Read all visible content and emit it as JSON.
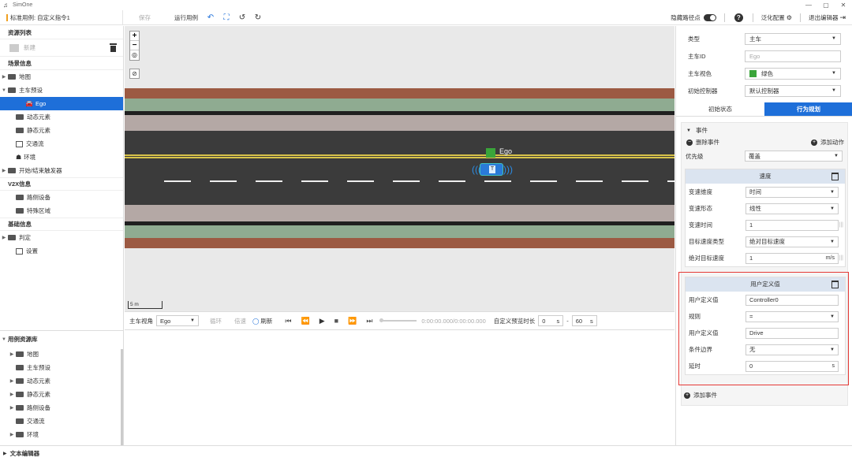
{
  "app": {
    "title": "SimOne"
  },
  "window_controls": {
    "minimize": "—",
    "maximize": "▢",
    "close": "✕"
  },
  "toolbar": {
    "case_name": "标准用例: 自定义指令1",
    "save_label": "保存",
    "run_label": "运行用例",
    "hide_path_label": "隐藏路径点",
    "generalize_label": "泛化配置",
    "exit_label": "退出编辑器"
  },
  "left": {
    "resource_list": "资源列表",
    "new_label": "新建",
    "scene_info": "场景信息",
    "scene_items": [
      {
        "label": "地图"
      },
      {
        "label": "主车预设"
      },
      {
        "label": "Ego"
      },
      {
        "label": "动态元素"
      },
      {
        "label": "静态元素"
      },
      {
        "label": "交通流"
      },
      {
        "label": "环境"
      },
      {
        "label": "开始/结束触发器"
      }
    ],
    "v2x_info": "V2X信息",
    "v2x_items": [
      {
        "label": "路侧设备"
      },
      {
        "label": "特殊区域"
      }
    ],
    "base_info": "基础信息",
    "base_items": [
      {
        "label": "判定"
      },
      {
        "label": "设置"
      }
    ],
    "lib_header": "用例资源库",
    "lib_items": [
      {
        "label": "地图"
      },
      {
        "label": "主车预设"
      },
      {
        "label": "动态元素"
      },
      {
        "label": "静态元素"
      },
      {
        "label": "路侧设备"
      },
      {
        "label": "交通流"
      },
      {
        "label": "环境"
      }
    ]
  },
  "canvas": {
    "ego_label": "Ego",
    "scale_label": "5 m",
    "zoom_in": "+",
    "zoom_out": "−"
  },
  "playbar": {
    "view_label": "主车视角",
    "view_value": "Ego",
    "loop_label": "循环",
    "speed_label": "倍速",
    "refresh_label": "刷新",
    "time_display": "0:00:00.000/0:00:00.000",
    "preview_label": "自定义预览时长",
    "start_value": "0",
    "end_value": "60",
    "unit_s": "s",
    "dash": "-"
  },
  "text_editor": "文本编辑器",
  "right": {
    "props": [
      {
        "label": "类型",
        "value": "主车",
        "type": "select"
      },
      {
        "label": "主车ID",
        "value": "Ego",
        "type": "input"
      },
      {
        "label": "主车视色",
        "value": "绿色",
        "type": "color"
      },
      {
        "label": "初始控制器",
        "value": "默认控制器",
        "type": "select"
      }
    ],
    "tab_initial": "初始状态",
    "tab_behavior": "行为规划",
    "event_label": "事件",
    "delete_event": "删除事件",
    "add_action": "添加动作",
    "priority_label": "优先级",
    "priority_value": "覆盖",
    "speed_card": {
      "title": "速度",
      "fields": [
        {
          "label": "变速维度",
          "value": "时间"
        },
        {
          "label": "变速形态",
          "value": "线性"
        },
        {
          "label": "变速时间",
          "value": "1"
        },
        {
          "label": "目标速度类型",
          "value": "绝对目标速度"
        },
        {
          "label": "绝对目标速度",
          "value": "1",
          "unit": "m/s"
        }
      ]
    },
    "user_card": {
      "title": "用户定义值",
      "fields": [
        {
          "label": "用户定义值",
          "value": "Controller0"
        },
        {
          "label": "规则",
          "value": "="
        },
        {
          "label": "用户定义值",
          "value": "Drive"
        },
        {
          "label": "条件边界",
          "value": "无"
        },
        {
          "label": "延时",
          "value": "0",
          "unit": "s"
        }
      ]
    },
    "add_event": "添加事件"
  },
  "colors": {
    "accent": "#1e6fd9",
    "highlight_border": "#e53935",
    "ego_green": "#3aa53a"
  }
}
